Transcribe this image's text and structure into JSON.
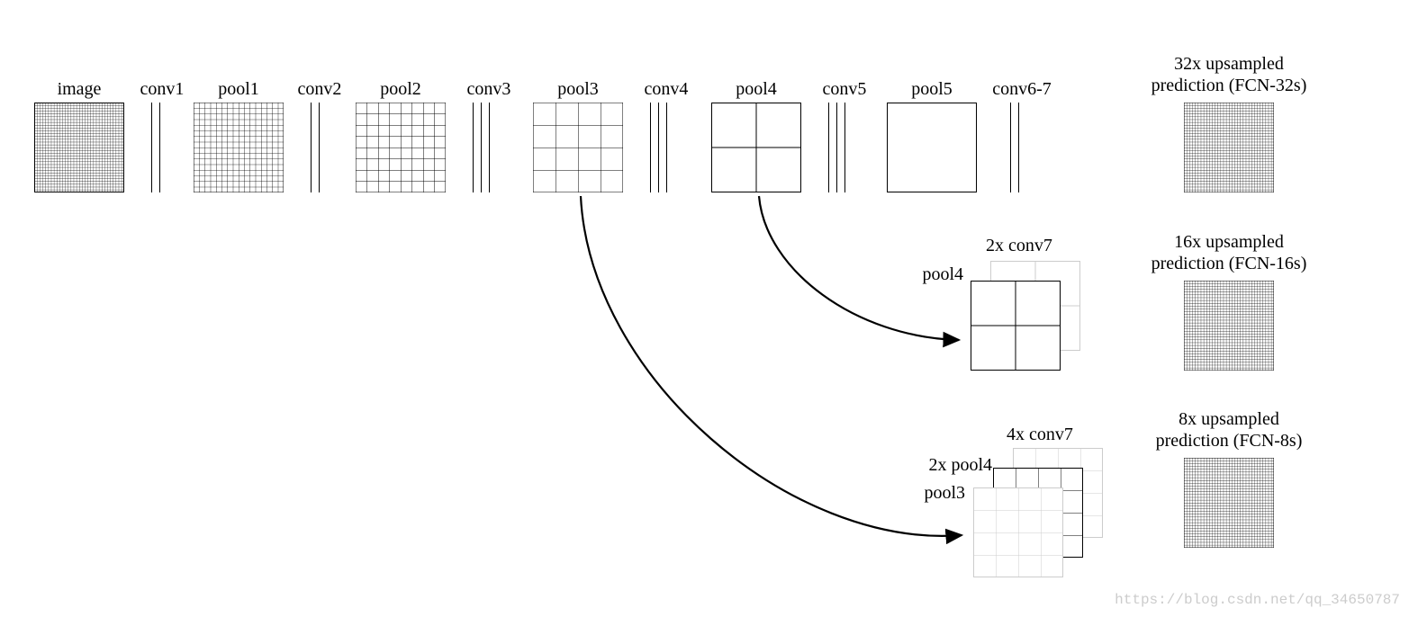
{
  "watermark": "https://blog.csdn.net/qq_34650787",
  "row_labels": {
    "image": "image",
    "conv1": "conv1",
    "pool1": "pool1",
    "conv2": "conv2",
    "pool2": "pool2",
    "conv3": "conv3",
    "pool3": "pool3",
    "conv4": "conv4",
    "pool4": "pool4",
    "conv5": "conv5",
    "pool5": "pool5",
    "conv67": "conv6-7"
  },
  "predictions": {
    "p32_line1": "32x upsampled",
    "p32_line2": "prediction (FCN-32s)",
    "p16_line1": "16x upsampled",
    "p16_line2": "prediction (FCN-16s)",
    "p8_line1": "8x upsampled",
    "p8_line2": "prediction (FCN-8s)"
  },
  "fuse16": {
    "top": "2x conv7",
    "left": "pool4"
  },
  "fuse8": {
    "top": "4x conv7",
    "mid": "2x pool4",
    "bot": "pool3"
  },
  "chart_data": {
    "type": "table",
    "title": "FCN architecture skip-connection diagram",
    "pipeline": [
      {
        "name": "image",
        "cells": 32
      },
      {
        "name": "conv1",
        "kind": "conv",
        "bars": 2
      },
      {
        "name": "pool1",
        "cells": 16
      },
      {
        "name": "conv2",
        "kind": "conv",
        "bars": 2
      },
      {
        "name": "pool2",
        "cells": 8
      },
      {
        "name": "conv3",
        "kind": "conv",
        "bars": 3
      },
      {
        "name": "pool3",
        "cells": 4
      },
      {
        "name": "conv4",
        "kind": "conv",
        "bars": 3
      },
      {
        "name": "pool4",
        "cells": 2
      },
      {
        "name": "conv5",
        "kind": "conv",
        "bars": 3
      },
      {
        "name": "pool5",
        "cells": 1
      },
      {
        "name": "conv6-7",
        "kind": "conv",
        "bars": 2
      }
    ],
    "outputs": [
      {
        "name": "FCN-32s",
        "upsample": 32,
        "fuse": [
          "conv7"
        ]
      },
      {
        "name": "FCN-16s",
        "upsample": 16,
        "fuse": [
          "2x conv7",
          "pool4"
        ]
      },
      {
        "name": "FCN-8s",
        "upsample": 8,
        "fuse": [
          "4x conv7",
          "2x pool4",
          "pool3"
        ]
      }
    ]
  }
}
